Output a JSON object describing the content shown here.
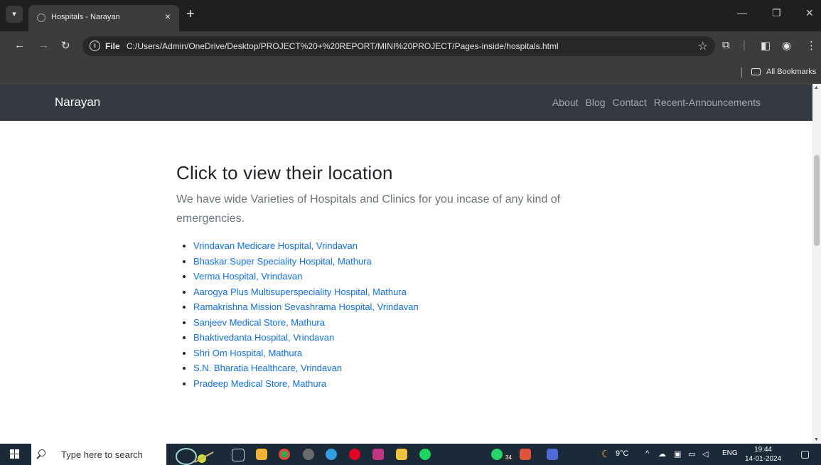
{
  "browser": {
    "tab_title": "Hospitals - Narayan",
    "tab_close": "×",
    "new_tab": "+",
    "url_scheme": "File",
    "url": "C:/Users/Admin/OneDrive/Desktop/PROJECT%20+%20REPORT/MINI%20PROJECT/Pages-inside/hospitals.html",
    "bookmarks_label": "All Bookmarks"
  },
  "site": {
    "brand": "Narayan",
    "nav": [
      "About",
      "Blog",
      "Contact",
      "Recent-Announcements"
    ],
    "heading": "Click to view their location",
    "lead": "We have wide Varieties of Hospitals and Clinics for you incase of any kind of emergencies.",
    "hospitals": [
      "Vrindavan Medicare Hospital, Vrindavan",
      "Bhaskar Super Speciality Hospital, Mathura",
      "Verma Hospital, Vrindavan",
      "Aarogya Plus Multisuperspeciality Hospital, Mathura",
      "Ramakrishna Mission Sevashrama Hospital, Vrindavan",
      "Sanjeev Medical Store, Mathura",
      "Bhaktivedanta Hospital, Vrindavan",
      "Shri Om Hospital, Mathura",
      "S.N. Bharatia Healthcare, Vrindavan",
      "Pradeep Medical Store, Mathura"
    ]
  },
  "taskbar": {
    "search_placeholder": "Type here to search",
    "whatsapp_badge": "34",
    "temperature": "9°C",
    "language": "ENG",
    "time": "19:44",
    "date": "14-01-2024"
  },
  "colors": {
    "navbar": "#343a40",
    "link": "#0d6efd",
    "heading": "#212529",
    "lead": "#6c757d",
    "taskbar": "#1a2a38"
  }
}
